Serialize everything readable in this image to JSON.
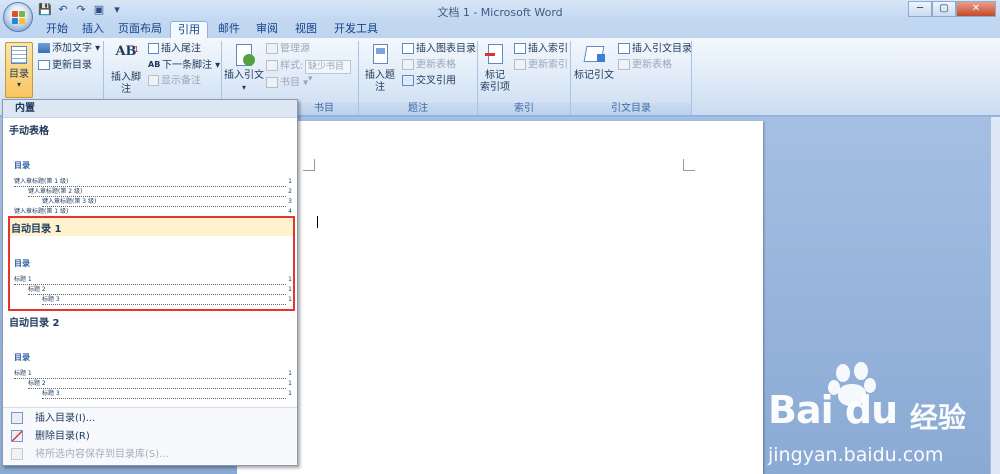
{
  "window": {
    "title": "文档 1 - Microsoft Word",
    "buttons": {
      "minimize": "─",
      "maximize": "▢",
      "close": "✕"
    }
  },
  "tabs": [
    "开始",
    "插入",
    "页面布局",
    "引用",
    "邮件",
    "审阅",
    "视图",
    "开发工具"
  ],
  "active_tab": "引用",
  "ribbon": {
    "toc_group": {
      "toc_button": "目录",
      "add_text": "添加文字",
      "update_toc": "更新目录"
    },
    "footnote_group": {
      "insert_footnote": "插入脚注",
      "insert_endnote": "插入尾注",
      "next_footnote": "下一条脚注",
      "show_notes": "显示备注"
    },
    "citation_group": {
      "insert_citation": "插入引文",
      "manage_sources": "管理源",
      "style_label": "样式:",
      "style_value": "缺少书目",
      "bibliography": "书目",
      "label": "书目"
    },
    "captions_group": {
      "insert_caption": "插入题注",
      "insert_table_of_figures": "插入图表目录",
      "update_table": "更新表格",
      "cross_reference": "交叉引用",
      "label": "题注"
    },
    "index_group": {
      "mark_entry_line1": "标记",
      "mark_entry_line2": "索引项",
      "insert_index": "插入索引",
      "update_index": "更新索引",
      "label": "索引"
    },
    "toa_group": {
      "mark_citation": "标记引文",
      "insert_toa": "插入引文目录",
      "update_table": "更新表格",
      "label": "引文目录"
    }
  },
  "dropdown": {
    "header": "内置",
    "manual": {
      "title": "手动表格",
      "preview_heading": "目录",
      "lines": [
        {
          "text": "键入章标题(第 1 级)",
          "page": "1",
          "indent": 0
        },
        {
          "text": "键入章标题(第 2 级)",
          "page": "2",
          "indent": 1
        },
        {
          "text": "键入章标题(第 3 级)",
          "page": "3",
          "indent": 2
        },
        {
          "text": "键入章标题(第 1 级)",
          "page": "4",
          "indent": 0
        }
      ]
    },
    "auto1": {
      "title": "自动目录 1",
      "preview_heading": "目录",
      "lines": [
        {
          "text": "标题 1",
          "page": "1",
          "indent": 0
        },
        {
          "text": "标题 2",
          "page": "1",
          "indent": 1
        },
        {
          "text": "标题 3",
          "page": "1",
          "indent": 2
        }
      ]
    },
    "auto2": {
      "title": "自动目录 2",
      "preview_heading": "目录",
      "lines": [
        {
          "text": "标题 1",
          "page": "1",
          "indent": 0
        },
        {
          "text": "标题 2",
          "page": "1",
          "indent": 1
        },
        {
          "text": "标题 3",
          "page": "1",
          "indent": 2
        }
      ]
    },
    "footer": {
      "insert_toc": "插入目录(I)...",
      "remove_toc": "删除目录(R)",
      "save_selection": "将所选内容保存到目录库(S)..."
    }
  },
  "watermark": {
    "brand": "Bai  du",
    "brand_cn": "经验",
    "url": "jingyan.baidu.com"
  }
}
